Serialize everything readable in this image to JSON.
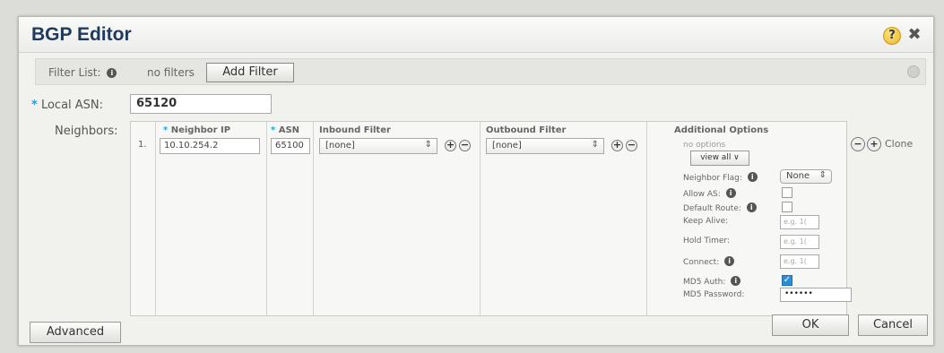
{
  "dialog": {
    "title": "BGP Editor",
    "help": "?",
    "close": "✖"
  },
  "filter": {
    "label": "Filter List:",
    "value": "no filters",
    "add_button": "Add Filter"
  },
  "local_asn": {
    "label": "Local ASN:",
    "value": "65120"
  },
  "neighbors": {
    "label": "Neighbors:",
    "columns": {
      "neighbor_ip": "Neighbor IP",
      "asn": "ASN",
      "inbound": "Inbound Filter",
      "outbound": "Outbound Filter",
      "options": "Additional Options"
    },
    "rows": [
      {
        "number": "1.",
        "neighbor_ip": "10.10.254.2",
        "asn": "65100",
        "inbound": "[none]",
        "outbound": "[none]",
        "options_summary": "no options",
        "view_all": "view all ∨"
      }
    ],
    "options": {
      "neighbor_flag": {
        "label": "Neighbor Flag:",
        "value": "None"
      },
      "allow_as": {
        "label": "Allow AS:",
        "checked": false
      },
      "default_route": {
        "label": "Default Route:",
        "checked": false
      },
      "keep_alive": {
        "label": "Keep Alive:",
        "placeholder": "e.g. 1("
      },
      "hold_timer": {
        "label": "Hold Timer:",
        "placeholder": "e.g. 1("
      },
      "connect": {
        "label": "Connect:",
        "placeholder": "e.g. 1("
      },
      "md5_auth": {
        "label": "MD5 Auth:",
        "checked": true
      },
      "md5_password": {
        "label": "MD5 Password:",
        "value": "••••••"
      }
    },
    "clone_label": "Clone"
  },
  "footer": {
    "advanced": "Advanced",
    "ok": "OK",
    "cancel": "Cancel"
  }
}
